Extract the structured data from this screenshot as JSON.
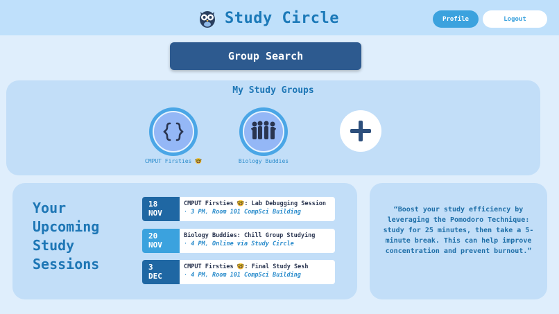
{
  "header": {
    "app_name": "Study Circle",
    "logo_icon": "owl-icon",
    "profile_label": "Profile",
    "logout_label": "Logout"
  },
  "group_search": {
    "label": "Group Search"
  },
  "groups": {
    "title": "My Study Groups",
    "items": [
      {
        "name": "CMPUT Firsties 🤓",
        "icon": "code-braces-icon"
      },
      {
        "name": "Biology Buddies",
        "icon": "people-group-icon"
      }
    ],
    "add_icon": "plus-icon"
  },
  "sessions": {
    "heading": "Your Upcoming Study Sessions",
    "items": [
      {
        "day": "18",
        "month": "NOV",
        "date_color": "#1f67a3",
        "title": "CMPUT Firsties 🤓: Lab Debugging Session",
        "time": "3 PM",
        "location": "Room 101 CompSci Building"
      },
      {
        "day": "20",
        "month": "NOV",
        "date_color": "#3ba2de",
        "title": "Biology Buddies: Chill Group Studying",
        "time": "4 PM",
        "location": "Online via Study Circle"
      },
      {
        "day": "3",
        "month": "DEC",
        "date_color": "#1f67a3",
        "title": "CMPUT Firsties 🤓: Final Study Sesh",
        "time": "4 PM",
        "location": "Room 101 CompSci Building"
      }
    ]
  },
  "tip": {
    "text": "“Boost your study efficiency by leveraging the Pomodoro Technique: study for 25 minutes, then take a 5-minute break. This can help improve concentration and prevent burnout.”"
  },
  "colors": {
    "background": "#dfeefc",
    "header": "#bfe0fb",
    "panel": "#c2def8",
    "accent": "#3ba2de",
    "dark_button": "#2d5a8f"
  }
}
